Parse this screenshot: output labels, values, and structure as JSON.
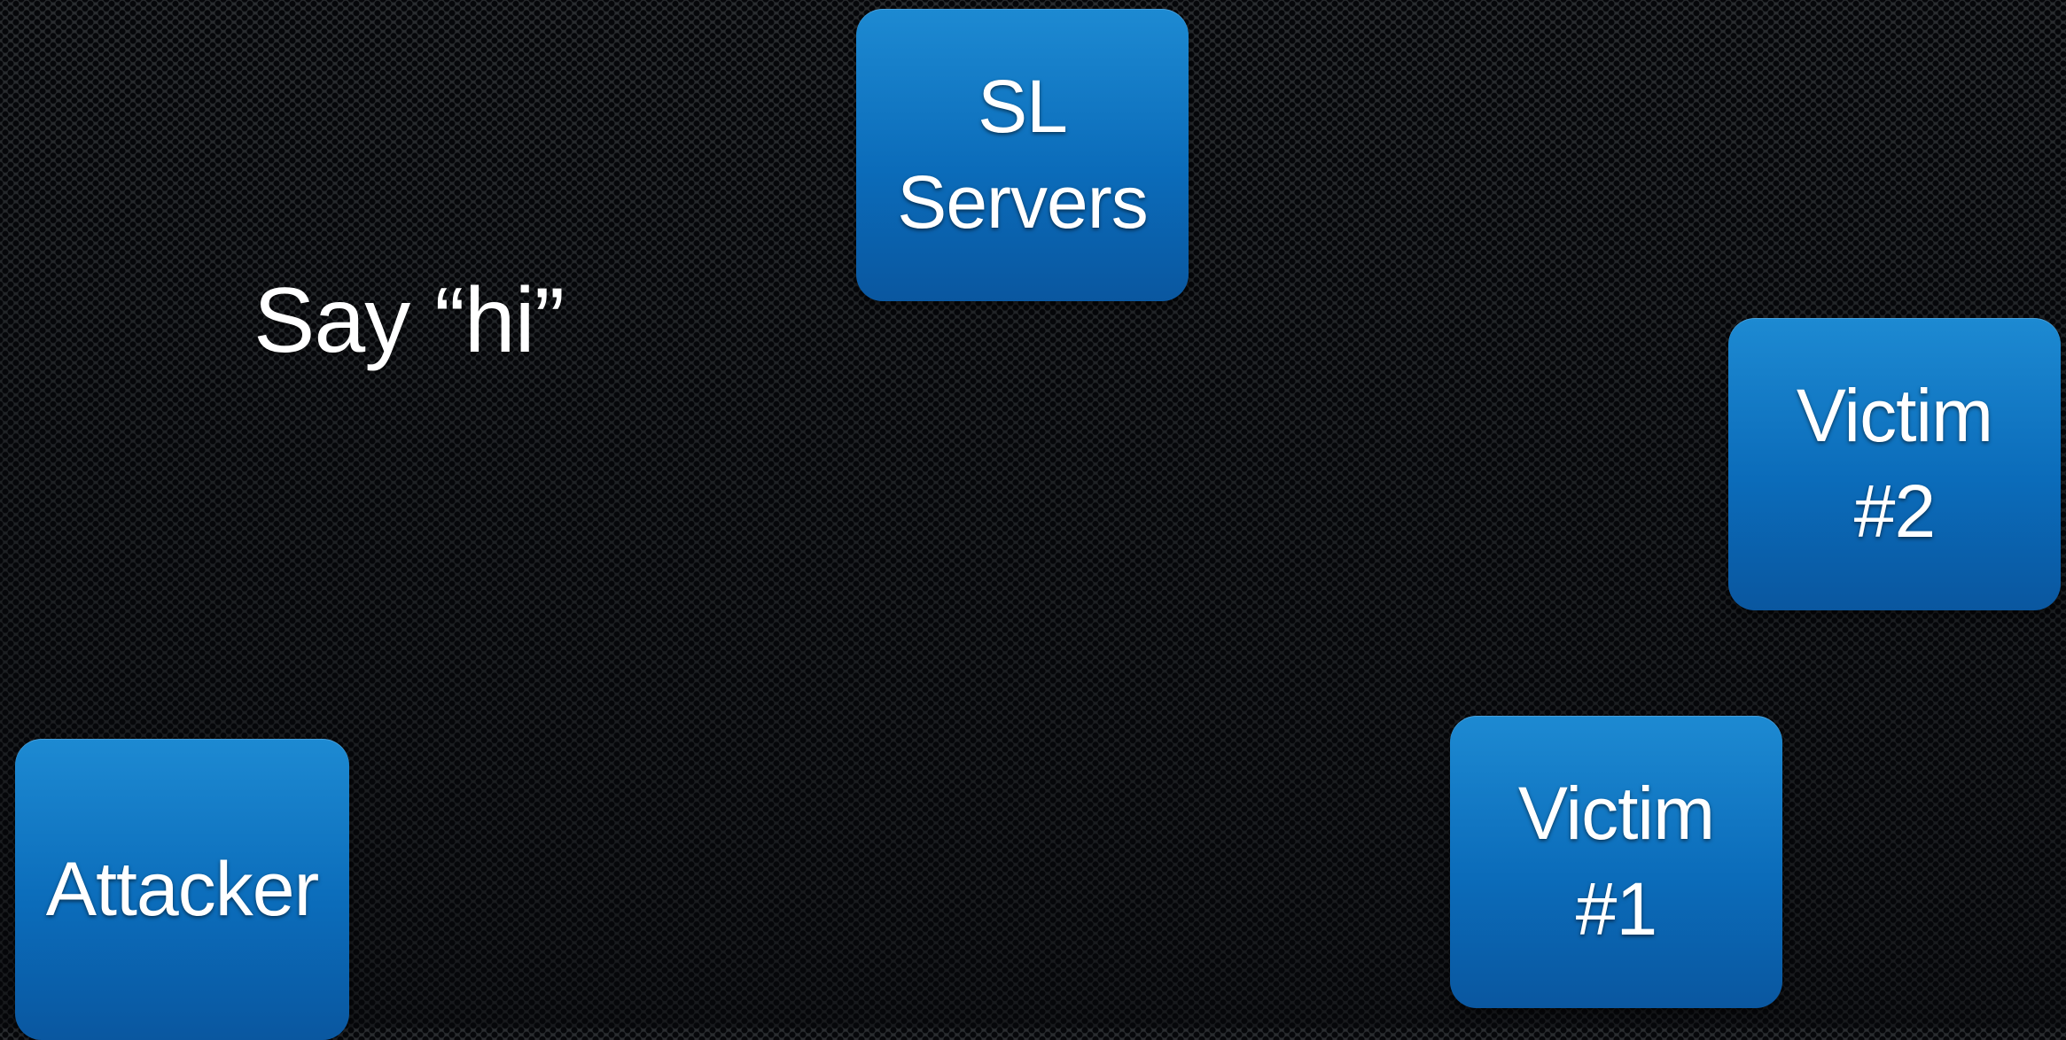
{
  "caption": "Say “hi”",
  "nodes": {
    "sl_servers": {
      "line1": "SL",
      "line2": "Servers"
    },
    "victim_2": {
      "line1": "Victim",
      "line2": "#2"
    },
    "victim_1": {
      "line1": "Victim",
      "line2": "#1"
    },
    "attacker": {
      "line1": "Attacker"
    }
  },
  "colors": {
    "node_fill": "#0b6cba",
    "background": "#17191b",
    "text": "#ffffff"
  }
}
